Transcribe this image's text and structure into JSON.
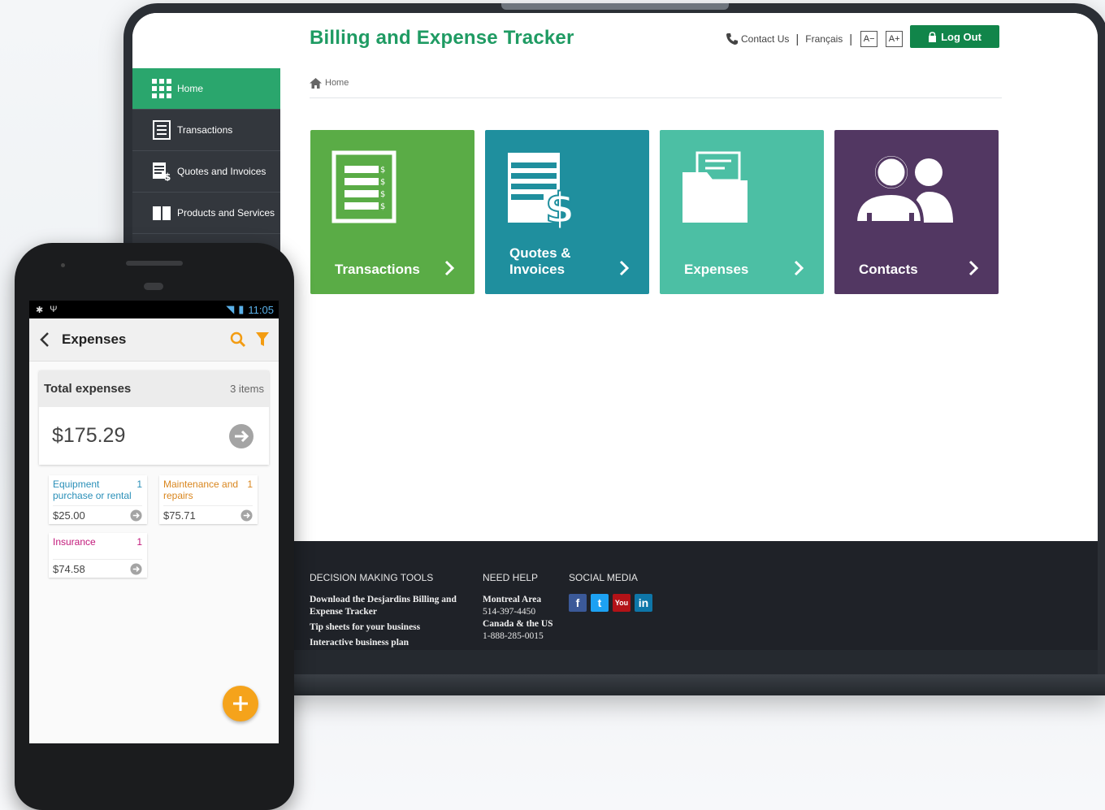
{
  "desktop": {
    "title": "Billing and Expense Tracker",
    "header": {
      "contact": "Contact Us",
      "language": "Français",
      "font_decrease": "A−",
      "font_increase": "A+",
      "logout": "Log Out"
    },
    "sidebar": {
      "items": [
        {
          "label": "Home",
          "icon": "grid-icon"
        },
        {
          "label": "Transactions",
          "icon": "list-icon"
        },
        {
          "label": "Quotes and Invoices",
          "icon": "invoice-icon"
        },
        {
          "label": "Products and Services",
          "icon": "book-icon"
        }
      ]
    },
    "breadcrumb": "Home",
    "tiles": [
      {
        "label": "Transactions",
        "color": "#5aac46",
        "icon": "ledger-icon"
      },
      {
        "label_line1": "Quotes &",
        "label_line2": "Invoices",
        "color": "#1f8f9e",
        "icon": "invoice-dollar-icon"
      },
      {
        "label": "Expenses",
        "color": "#4cbfa4",
        "icon": "folder-icon"
      },
      {
        "label": "Contacts",
        "color": "#523762",
        "icon": "contacts-icon"
      }
    ],
    "footer": {
      "tools": {
        "heading": "DECISION MAKING TOOLS",
        "links": [
          "Download the Desjardins Billing and Expense Tracker",
          "Tip sheets for your business",
          "Interactive business plan"
        ]
      },
      "help": {
        "heading": "NEED HELP",
        "area1": "Montreal Area",
        "phone1": "514-397-4450",
        "area2": "Canada & the US",
        "phone2": "1-888-285-0015"
      },
      "social": {
        "heading": "SOCIAL MEDIA",
        "networks": [
          {
            "glyph": "f",
            "color": "#3b5998",
            "icon": "facebook-icon"
          },
          {
            "glyph": "t",
            "color": "#1da1f2",
            "icon": "twitter-icon"
          },
          {
            "glyph": "You",
            "color": "#b31217",
            "icon": "youtube-icon"
          },
          {
            "glyph": "in",
            "color": "#0e76a8",
            "icon": "linkedin-icon"
          }
        ]
      }
    }
  },
  "mobile": {
    "status": {
      "time": "11:05"
    },
    "toolbar": {
      "title": "Expenses"
    },
    "total": {
      "label": "Total expenses",
      "count": "3 items",
      "amount": "$175.29"
    },
    "categories": [
      {
        "name": "Equipment purchase or rental",
        "count": "1",
        "amount": "$25.00",
        "color": "#2a8fb8"
      },
      {
        "name": "Maintenance and repairs",
        "count": "1",
        "amount": "$75.71",
        "color": "#d9861e"
      },
      {
        "name": "Insurance",
        "count": "1",
        "amount": "$74.58",
        "color": "#c2187a"
      }
    ]
  }
}
